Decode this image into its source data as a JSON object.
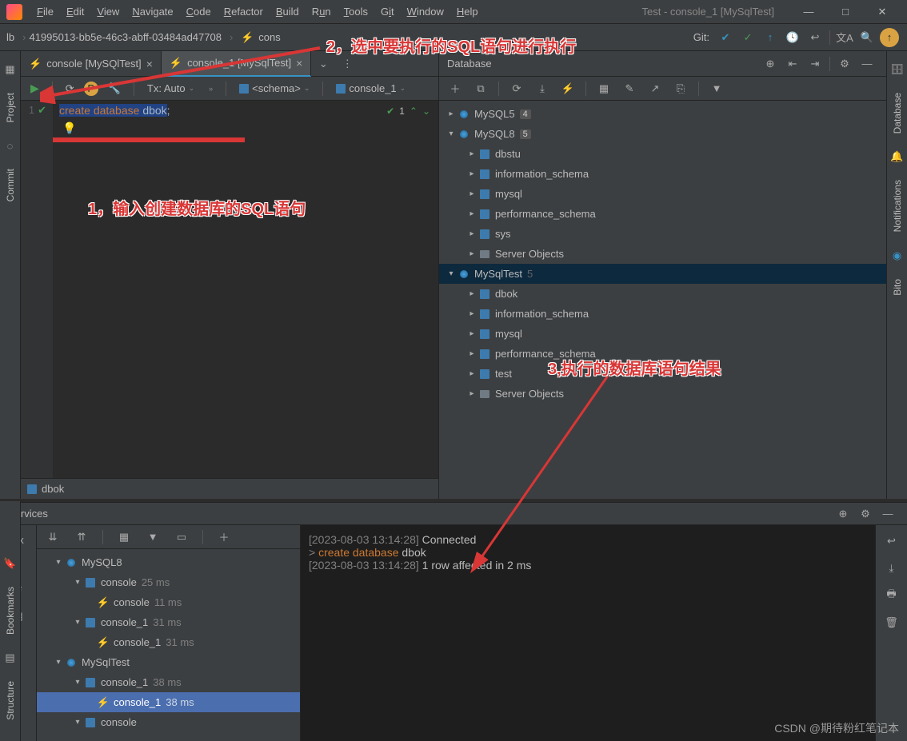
{
  "window_title": "Test - console_1 [MySqlTest]",
  "menubar": [
    "File",
    "Edit",
    "View",
    "Navigate",
    "Code",
    "Refactor",
    "Build",
    "Run",
    "Tools",
    "Git",
    "Window",
    "Help"
  ],
  "breadcrumb": {
    "first": "lb",
    "second": "41995013-bb5e-46c3-abff-03484ad47708",
    "third": "cons"
  },
  "git_label": "Git:",
  "tabs": [
    {
      "label": "console [MySQlTest]",
      "active": false
    },
    {
      "label": "console_1 [MySqlTest]",
      "active": true
    }
  ],
  "editor_toolbar": {
    "tx": "Tx: Auto",
    "schema": "<schema>",
    "console": "console_1"
  },
  "code": {
    "line": "1",
    "kw1": "create",
    "kw2": "database",
    "ident": "dbok",
    "tail": ";"
  },
  "inspection": {
    "count": "1"
  },
  "status_schema": "dbok",
  "db_panel": {
    "title": "Database"
  },
  "db_tree": {
    "mysql5": {
      "name": "MySQL5",
      "count": "4"
    },
    "mysql8": {
      "name": "MySQL8",
      "count": "5",
      "children": [
        "dbstu",
        "information_schema",
        "mysql",
        "performance_schema",
        "sys",
        "Server Objects"
      ]
    },
    "mysqltest": {
      "name": "MySqlTest",
      "count": "5",
      "children": [
        "dbok",
        "information_schema",
        "mysql",
        "performance_schema",
        "test",
        "Server Objects"
      ]
    }
  },
  "services": {
    "title": "Services",
    "tree": {
      "mysql8": {
        "name": "MySQL8",
        "console": {
          "name": "console",
          "t": "25 ms",
          "child": {
            "name": "console",
            "t": "11 ms"
          }
        },
        "console1": {
          "name": "console_1",
          "t": "31 ms",
          "child": {
            "name": "console_1",
            "t": "31 ms"
          }
        }
      },
      "mysqltest": {
        "name": "MySqlTest",
        "console1": {
          "name": "console_1",
          "t": "38 ms",
          "child": {
            "name": "console_1",
            "t": "38 ms"
          }
        },
        "console": {
          "name": "console"
        }
      }
    },
    "output": {
      "l1_ts": "[2023-08-03 13:14:28]",
      "l1_txt": "Connected",
      "l2_prompt": ">",
      "l2_kw1": "create",
      "l2_kw2": "database",
      "l2_id": "dbok",
      "l3_ts": "[2023-08-03 13:14:28]",
      "l3_txt": "1 row affected in 2 ms"
    }
  },
  "sidebar_left": [
    "Project",
    "Commit"
  ],
  "sidebar_left_bottom": [
    "Bookmarks",
    "Structure"
  ],
  "sidebar_right": [
    "Database",
    "Notifications",
    "Bito"
  ],
  "annotations": {
    "a1": "1，输入创建数据库的SQL语句",
    "a2": "2，选中要执行的SQL语句进行执行",
    "a3": "3,执行的数据库语句结果"
  },
  "watermark": "CSDN @期待粉红笔记本"
}
